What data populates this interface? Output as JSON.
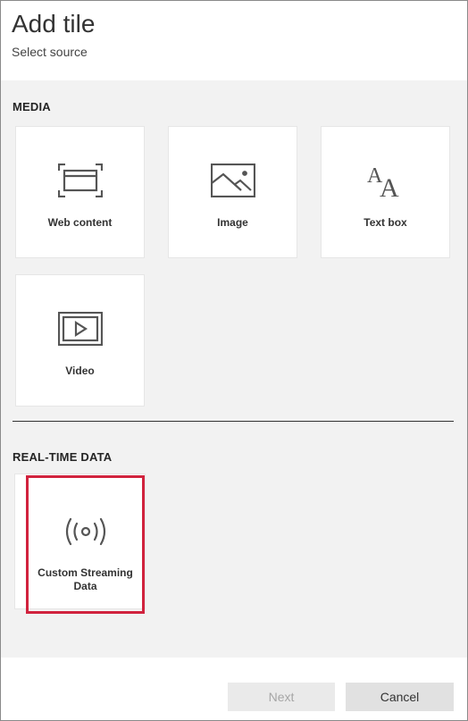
{
  "dialog": {
    "title": "Add tile",
    "subtitle": "Select source"
  },
  "media": {
    "section_title": "MEDIA",
    "tiles": [
      {
        "label": "Web content",
        "icon": "web-content-icon"
      },
      {
        "label": "Image",
        "icon": "image-icon"
      },
      {
        "label": "Text box",
        "icon": "text-box-icon"
      },
      {
        "label": "Video",
        "icon": "video-icon"
      }
    ]
  },
  "realtime": {
    "section_title": "REAL-TIME DATA",
    "tiles": [
      {
        "label": "Custom Streaming Data",
        "icon": "streaming-icon",
        "selected": true
      }
    ]
  },
  "footer": {
    "next_label": "Next",
    "cancel_label": "Cancel"
  },
  "colors": {
    "highlight": "#d1233e",
    "panel_bg": "#f2f2f2",
    "icon": "#555555"
  }
}
